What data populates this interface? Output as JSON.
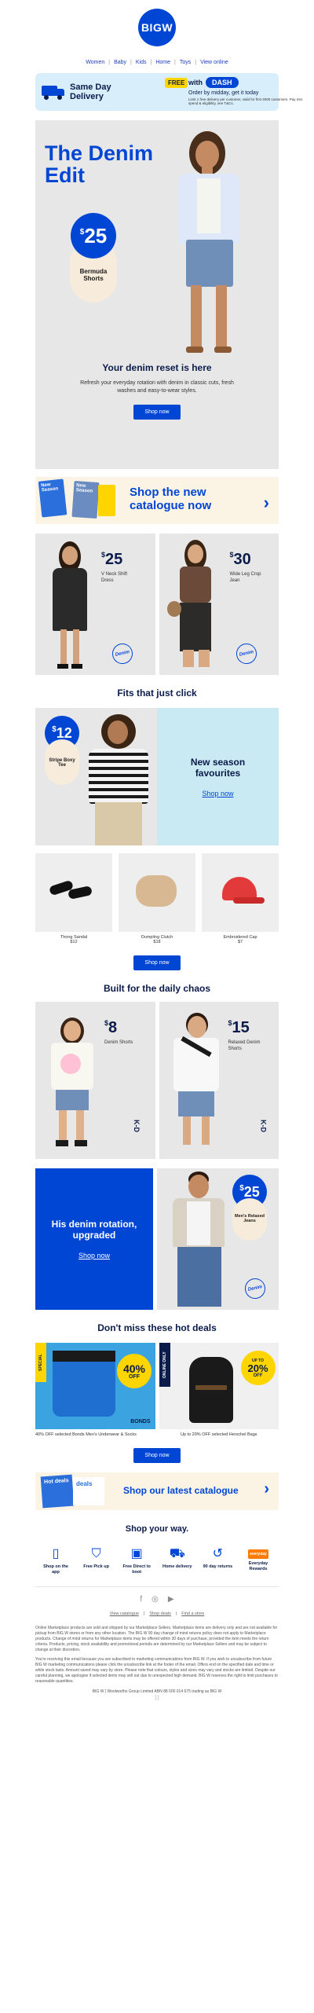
{
  "header": {
    "logo_text": "BIGW"
  },
  "nav": [
    "Women",
    "Baby",
    "Kids",
    "Home",
    "Toys",
    "View online"
  ],
  "delivery": {
    "title": "Same Day Delivery",
    "free": "FREE",
    "with": "with",
    "dash": "DASH",
    "sub": "Order by midday, get it today",
    "fine": "Limit 1 free delivery per customer, valid for first 2000 customers. Pay min. spend & eligibility, see T&Cs."
  },
  "hero": {
    "title": "The Denim Edit",
    "price_cur": "$",
    "price": "25",
    "price_label": "Bermuda Shorts",
    "subtitle": "Your denim reset is here",
    "desc": "Refresh your everyday rotation with denim in classic cuts, fresh washes and easy-to-wear styles.",
    "cta": "Shop now"
  },
  "catalogue": {
    "thumb1": "New Season",
    "thumb2": "New Season",
    "title": "Shop the new catalogue now",
    "arrow": "›"
  },
  "two_up": [
    {
      "cur": "$",
      "price": "25",
      "desc": "V Neck Shift Dress",
      "stamp": "Denim"
    },
    {
      "cur": "$",
      "price": "30",
      "desc": "Wide Leg Crop Jean",
      "stamp": "Denim"
    }
  ],
  "fits": {
    "title": "Fits that just click",
    "cur": "$",
    "price": "12",
    "label": "Stripe Boxy Tee",
    "right_title": "New season favourites",
    "right_link": "Shop now"
  },
  "trio": [
    {
      "name": "Thong Sandal",
      "price": "$12"
    },
    {
      "name": "Dumpling Clutch",
      "price": "$18"
    },
    {
      "name": "Embroidered Cap",
      "price": "$7"
    }
  ],
  "trio_cta": "Shop now",
  "chaos": {
    "title": "Built for the daily chaos",
    "tiles": [
      {
        "cur": "$",
        "price": "8",
        "desc": "Denim Shorts",
        "mark": "K-D"
      },
      {
        "cur": "$",
        "price": "15",
        "desc": "Relaxed Denim Shorts",
        "mark": "K-D"
      }
    ]
  },
  "his": {
    "title": "His denim rotation, upgraded",
    "link": "Shop now",
    "cur": "$",
    "price": "25",
    "label": "Men's Relaxed Jeans",
    "stamp": "Denim"
  },
  "deals": {
    "title": "Don't miss these hot deals",
    "items": [
      {
        "tag": "SPECIAL",
        "up": "",
        "pct": "40%",
        "off": "OFF",
        "brand": "BONDS",
        "cap": "40% OFF selected Bonds Men's Underwear & Socks"
      },
      {
        "tag": "ONLINE ONLY",
        "up": "UP TO",
        "pct": "20%",
        "off": "OFF",
        "brand": "",
        "cap": "Up to 20% OFF selected Herschel Bags"
      }
    ],
    "cta": "Shop now"
  },
  "latest": {
    "thumb1": "Hot deals",
    "thumb2": "deals",
    "title": "Shop our latest catalogue",
    "arrow": "›"
  },
  "ways": {
    "title": "Shop your way.",
    "items": [
      {
        "icon": "phone-icon",
        "glyph": "▯",
        "label": "Shop on the app"
      },
      {
        "icon": "bag-icon",
        "glyph": "⛉",
        "label": "Free Pick up"
      },
      {
        "icon": "box-icon",
        "glyph": "▣",
        "label": "Free Direct to boot"
      },
      {
        "icon": "truck-icon",
        "glyph": "⛟",
        "label": "Home delivery"
      },
      {
        "icon": "return-icon",
        "glyph": "↺",
        "label": "90 day returns"
      },
      {
        "icon": "rewards-icon",
        "glyph": "",
        "label": "Everyday Rewards",
        "badge": "everyday"
      }
    ]
  },
  "socials": [
    "f",
    "◎",
    "▶"
  ],
  "foot_links": [
    "View catalogue",
    "Shop deals",
    "Find a store"
  ],
  "legal": [
    "Online Marketplace products are sold and shipped by our Marketplace Sellers. Marketplace items are delivery only and are not available for pickup from BIG W stores or from any other location. The BIG W 90 day change of mind returns policy does not apply to Marketplace products. Change of mind returns for Marketplace items may be offered within 30 days of purchase, provided the item meets the return criteria. Products, pricing, stock availability and promotional periods are determined by our Marketplace Sellers and may be subject to change at their discretion.",
    "You're receiving this email because you are subscribed to marketing communications from BIG W. If you wish to unsubscribe from future BIG W marketing communications please click the unsubscribe link at the footer of the email. Offers end on the specified date and time or while stock lasts. Amount saved may vary by store. Please note that colours, styles and sizes may vary and stocks are limited. Despite our careful planning, we apologise if selected items may sell out due to unexpected high demand. BIG W reserves the right to limit purchases to reasonable quantities."
  ],
  "address": "BIG W  |  Woolworths Group Limited ABN 88 000 014 675 trading as BIG W",
  "copy_icon": "[ ]"
}
